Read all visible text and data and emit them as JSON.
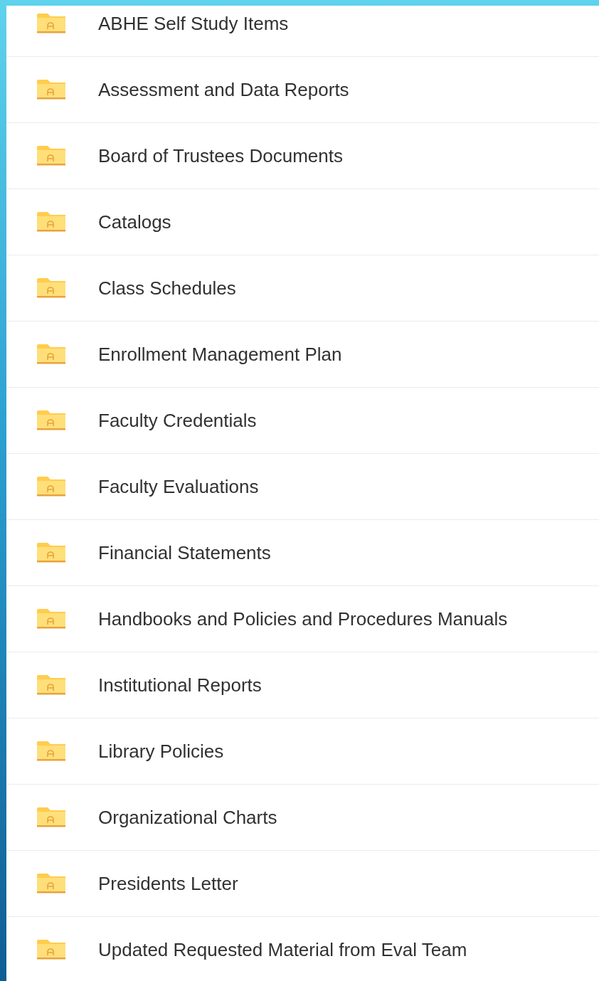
{
  "folders": [
    {
      "name": "ABHE Self Study Items"
    },
    {
      "name": "Assessment and Data Reports"
    },
    {
      "name": "Board of Trustees Documents"
    },
    {
      "name": "Catalogs"
    },
    {
      "name": "Class Schedules"
    },
    {
      "name": "Enrollment Management Plan"
    },
    {
      "name": "Faculty Credentials"
    },
    {
      "name": "Faculty Evaluations"
    },
    {
      "name": "Financial Statements"
    },
    {
      "name": "Handbooks and Policies and Procedures Manuals"
    },
    {
      "name": "Institutional Reports"
    },
    {
      "name": "Library Policies"
    },
    {
      "name": "Organizational Charts"
    },
    {
      "name": "Presidents Letter"
    },
    {
      "name": "Updated Requested Material from Eval Team"
    }
  ]
}
